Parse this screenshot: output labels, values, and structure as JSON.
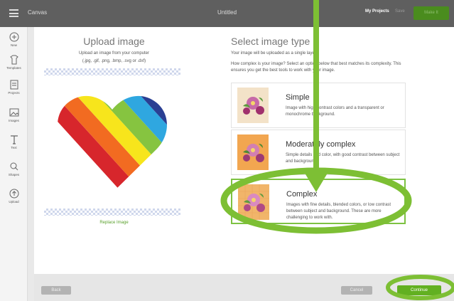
{
  "topbar": {
    "app_title": "Canvas",
    "doc_title": "Untitled",
    "my_projects": "My Projects",
    "save": "Save",
    "make": "Make It"
  },
  "sidebar": {
    "items": [
      {
        "label": "New",
        "icon": "new-icon"
      },
      {
        "label": "Templates",
        "icon": "templates-icon"
      },
      {
        "label": "Projects",
        "icon": "projects-icon"
      },
      {
        "label": "Images",
        "icon": "images-icon"
      },
      {
        "label": "Text",
        "icon": "text-icon"
      },
      {
        "label": "Shapes",
        "icon": "shapes-icon"
      },
      {
        "label": "Upload",
        "icon": "upload-icon"
      }
    ]
  },
  "upload": {
    "title": "Upload image",
    "subtitle": "Upload an image from your computer",
    "formats": "(.jpg, .gif, .png, .bmp, .svg or .dxf)",
    "replace": "Replace Image"
  },
  "select": {
    "title": "Select image type",
    "sub1": "Your image will be uploaded as a single layer.",
    "sub2": "How complex is your image? Select an option below that best matches its complexity. This ensures you get the best tools to work with your image.",
    "options": [
      {
        "name": "Simple",
        "desc": "Image with high-contrast colors and a transparent or monochrome background."
      },
      {
        "name": "Moderately complex",
        "desc": "Simple details and color, with good contrast between subject and background."
      },
      {
        "name": "Complex",
        "desc": "Images with fine details, blended colors, or low contrast between subject and background. These are more challenging to work with."
      }
    ]
  },
  "bottom": {
    "back": "Back",
    "cancel": "Cancel",
    "continue": "Continue"
  },
  "colors": {
    "accent": "#62b021",
    "annotation": "#7dbf34",
    "topbar": "#5f5f5f"
  },
  "heart_stripes": [
    "#d7262c",
    "#f26b21",
    "#f7e51c",
    "#86c440",
    "#2fa7e0",
    "#2a3f93"
  ]
}
